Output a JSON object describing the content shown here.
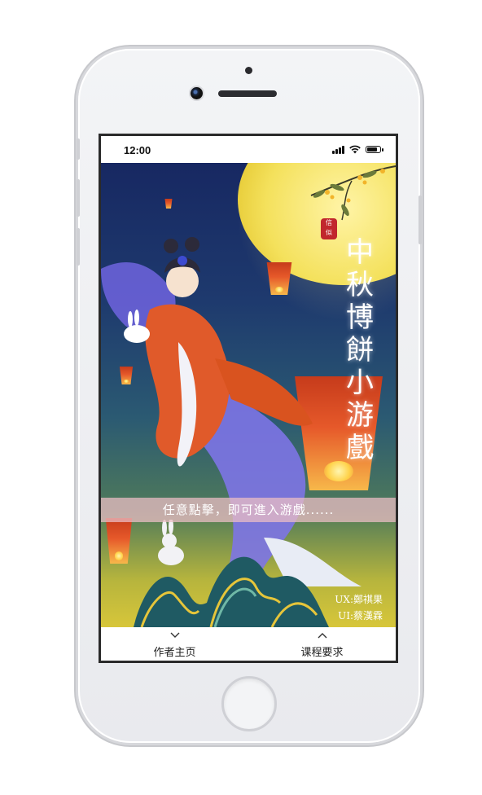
{
  "status_bar": {
    "time": "12:00"
  },
  "poster": {
    "title_chars": [
      "中",
      "秋",
      "博",
      "餅",
      "小",
      "游",
      "戲"
    ],
    "seal_text": "信\n似",
    "banner_text": "任意點擊，即可進入游戲......",
    "credits": {
      "ux": "UX:鄭祺果",
      "ui": "UI:蔡漢霖"
    }
  },
  "bottom_nav": {
    "left_label": "作者主页",
    "left_icon": "chevron-down-icon",
    "right_label": "课程要求",
    "right_icon": "chevron-up-icon"
  },
  "colors": {
    "sky_top": "#172862",
    "moon": "#f4e15c",
    "lantern": "#e6592a",
    "banner": "#ebbec4"
  }
}
